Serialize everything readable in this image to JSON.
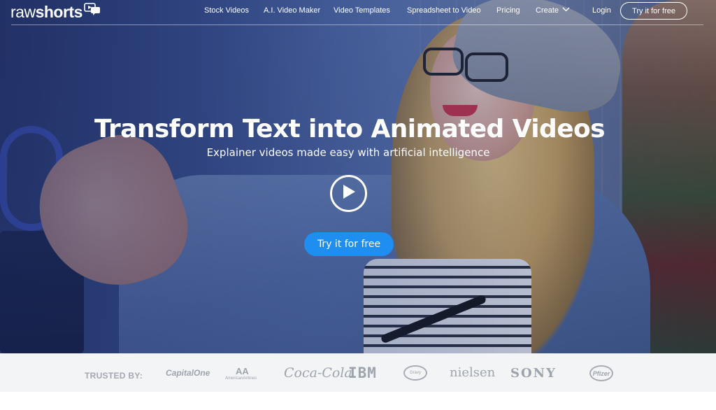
{
  "brand": {
    "logo_text_light": "raw",
    "logo_text_bold": "shorts"
  },
  "nav": {
    "links": [
      "Stock Videos",
      "A.I. Video Maker",
      "Video Templates",
      "Spreadsheet to Video",
      "Pricing",
      "Create",
      "Login"
    ],
    "cta_label": "Try it for free"
  },
  "hero": {
    "title": "Transform Text into Animated Videos",
    "subtitle": "Explainer videos made easy with artificial intelligence",
    "cta_label": "Try it for free"
  },
  "trusted": {
    "label": "TRUSTED BY:",
    "logos": [
      "CapitalOne",
      "AA",
      "AmericanAirlines",
      "Coca-Cola",
      "IBM",
      "Gravy",
      "nielsen",
      "SONY",
      "Pfizer"
    ]
  },
  "icons": {
    "logo_icon": "chat-bubble-play-icon",
    "create_chevron": "chevron-down-icon",
    "play": "play-icon"
  },
  "colors": {
    "accent": "#1f8ef1",
    "trusted_bg": "#f3f4f6",
    "trusted_text": "#a2a7b0"
  }
}
